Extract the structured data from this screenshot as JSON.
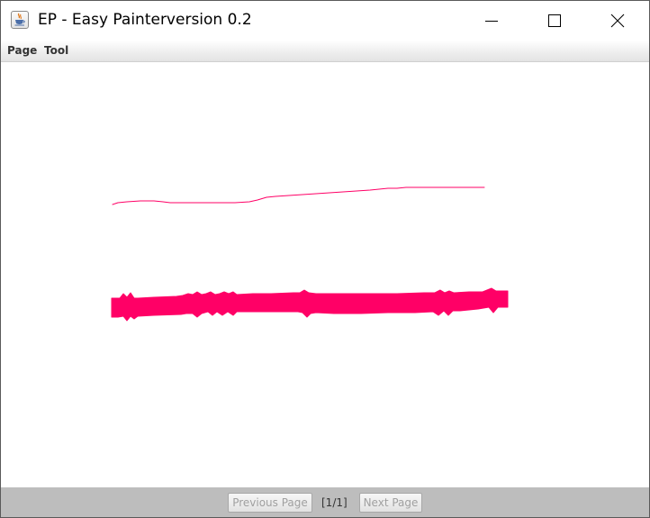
{
  "window": {
    "title": "EP - Easy Painterversion 0.2",
    "app_icon": "java-cup-icon",
    "controls": {
      "minimize_icon": "minimize-icon",
      "maximize_icon": "maximize-icon",
      "close_icon": "close-icon"
    }
  },
  "menu": {
    "items": [
      {
        "label": "Page"
      },
      {
        "label": "Tool"
      }
    ]
  },
  "canvas": {
    "background": "#ffffff",
    "stroke_color": "#ff0066"
  },
  "footer": {
    "background": "#bdbdbd",
    "prev_label": "Previous Page",
    "page_indicator": "[1/1]",
    "next_label": "Next Page"
  }
}
